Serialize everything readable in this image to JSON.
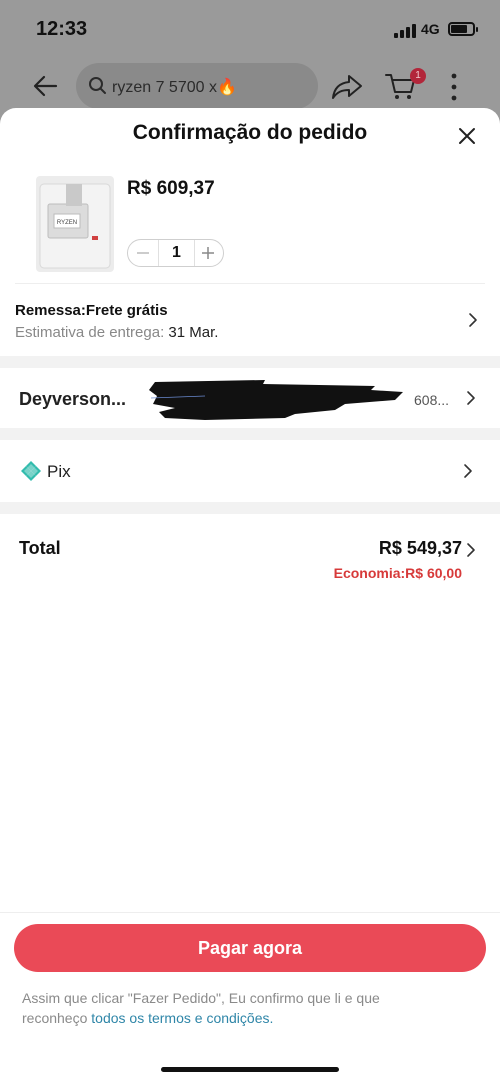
{
  "status_bar": {
    "time": "12:33",
    "network": "4G"
  },
  "background_app": {
    "search_query": "ryzen 7 5700 x🔥",
    "cart_badge": "1"
  },
  "sheet": {
    "title": "Confirmação do pedido",
    "product": {
      "price": "R$ 609,37",
      "quantity": "1",
      "image_label": "RYZEN"
    },
    "shipping": {
      "title": "Remessa:Frete grátis",
      "eta_label": "Estimativa de entrega:",
      "eta_date": "31 Mar."
    },
    "address": {
      "name": "Deyverson...",
      "tail": "608..."
    },
    "payment": {
      "method": "Pix"
    },
    "total": {
      "label": "Total",
      "value": "R$ 549,37",
      "savings": "Economia:R$ 60,00"
    },
    "pay_button": "Pagar agora",
    "legal": {
      "text": "Assim que clicar \"Fazer Pedido\", Eu confirmo que li e que reconheço",
      "link": "todos os termos e condições."
    }
  },
  "colors": {
    "accent": "#ea4a57",
    "savings": "#d73a3a",
    "link": "#2f86a8",
    "pix": "#32bcad"
  }
}
